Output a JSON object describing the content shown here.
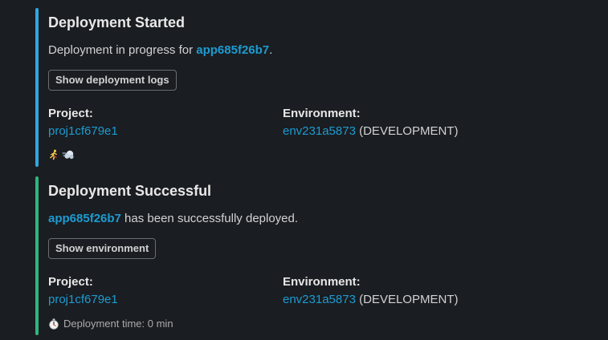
{
  "colors": {
    "started_bar": "#2fa8e0",
    "success_bar": "#2eb67d",
    "link": "#1d9bd1"
  },
  "started": {
    "title": "Deployment Started",
    "desc_prefix": "Deployment in progress for ",
    "app_link": "app685f26b7",
    "desc_suffix": ".",
    "button_label": "Show deployment logs",
    "project_label": "Project:",
    "project_value": "proj1cf679e1",
    "env_label": "Environment:",
    "env_value": "env231a5873",
    "env_kind": " (DEVELOPMENT)",
    "footer_icons": [
      "runner-icon",
      "dash-icon"
    ]
  },
  "success": {
    "title": "Deployment Successful",
    "app_link": "app685f26b7",
    "desc_suffix": " has been successfully deployed.",
    "button_label": "Show environment",
    "project_label": "Project:",
    "project_value": "proj1cf679e1",
    "env_label": "Environment:",
    "env_value": "env231a5873",
    "env_kind": " (DEVELOPMENT)",
    "footer_icon": "stopwatch-icon",
    "footer_text": "Deployment time: 0 min"
  }
}
